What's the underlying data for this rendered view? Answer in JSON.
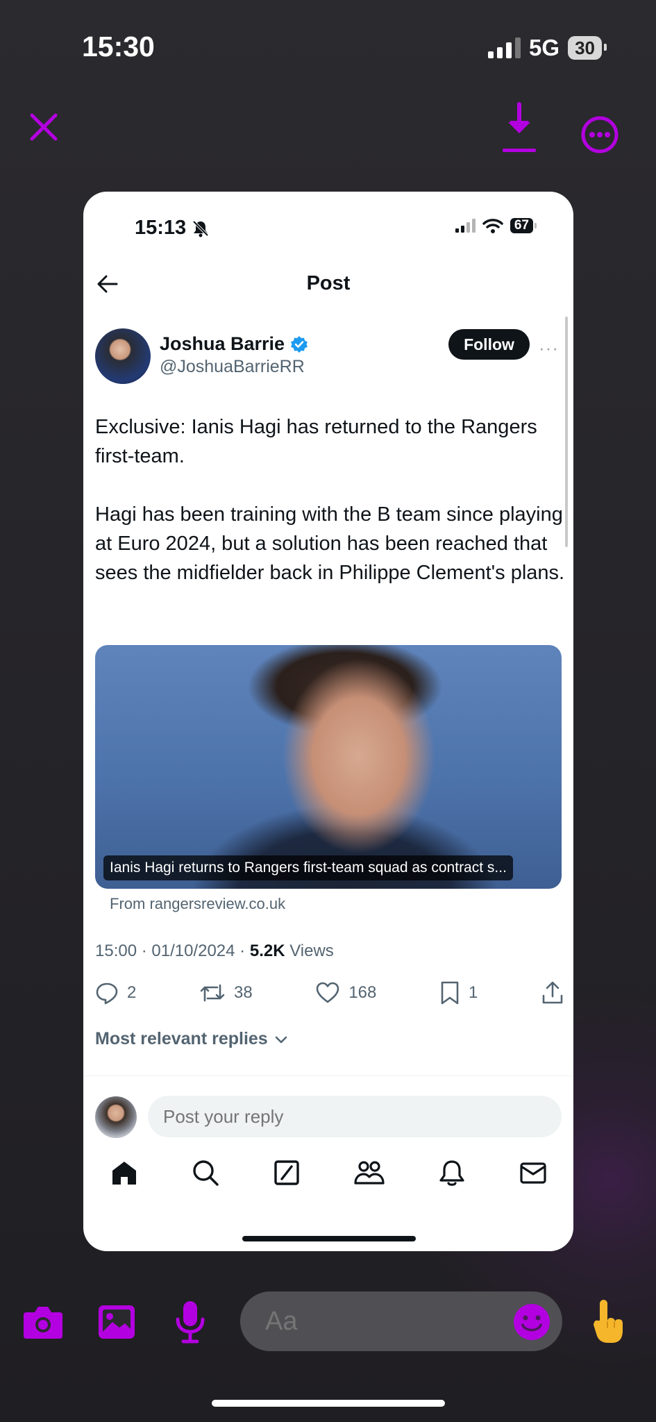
{
  "outer_status": {
    "time": "15:30",
    "network": "5G",
    "battery": "30"
  },
  "viewer": {
    "close_icon": "close-icon",
    "download_icon": "download-icon",
    "more_icon": "more-circle-icon"
  },
  "card": {
    "status": {
      "time": "15:13",
      "battery": "67"
    },
    "header": {
      "title": "Post"
    },
    "author": {
      "name": "Joshua Barrie",
      "handle": "@JoshuaBarrieRR",
      "verified": true
    },
    "follow_label": "Follow",
    "more_label": "···",
    "text": {
      "p1": "Exclusive: Ianis Hagi has returned to the Rangers first-team.",
      "p2": "Hagi has been training with the B team since playing at Euro 2024, but a solution has been reached that sees the midfielder back in Philippe Clement's plans."
    },
    "link_card": {
      "caption": "Ianis Hagi returns to Rangers first-team squad as contract s...",
      "source": "From rangersreview.co.uk"
    },
    "meta": {
      "datetime": "15:00 · 01/10/2024 · ",
      "views_count": "5.2K",
      "views_label": " Views"
    },
    "actions": {
      "replies": "2",
      "reposts": "38",
      "likes": "168",
      "bookmarks": "1"
    },
    "replies_sort": "Most relevant replies",
    "reply_placeholder": "Post your reply",
    "colors": {
      "verified": "#1d9bf0",
      "text": "#0f1419",
      "muted": "#536471"
    }
  },
  "bottom_bar": {
    "placeholder": "Aa",
    "accent": "#b300e0"
  }
}
